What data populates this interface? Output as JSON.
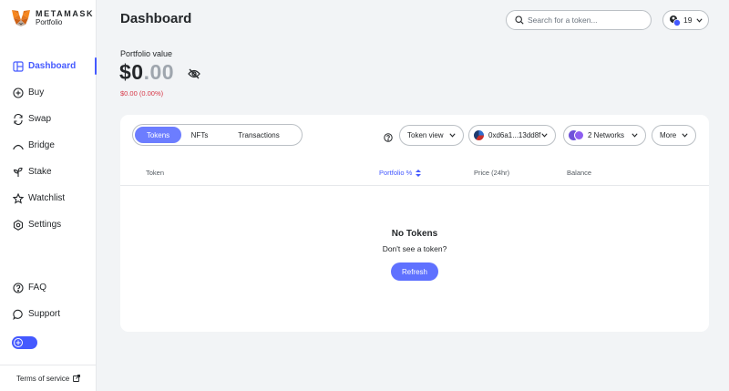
{
  "brand": {
    "title": "METAMASK",
    "subtitle": "Portfolio"
  },
  "sidebar": {
    "items": [
      {
        "label": "Dashboard",
        "icon": "dashboard-icon",
        "active": true
      },
      {
        "label": "Buy",
        "icon": "plus-circle-icon"
      },
      {
        "label": "Swap",
        "icon": "swap-icon"
      },
      {
        "label": "Bridge",
        "icon": "bridge-icon"
      },
      {
        "label": "Stake",
        "icon": "sprout-icon"
      },
      {
        "label": "Watchlist",
        "icon": "star-icon"
      },
      {
        "label": "Settings",
        "icon": "gear-icon"
      }
    ],
    "bottom_items": [
      {
        "label": "FAQ",
        "icon": "question-circle-icon"
      },
      {
        "label": "Support",
        "icon": "chat-bubble-icon"
      }
    ],
    "terms_label": "Terms of service"
  },
  "header": {
    "title": "Dashboard",
    "search_placeholder": "Search for a token...",
    "account_count": "19"
  },
  "portfolio": {
    "label": "Portfolio value",
    "value_dollars": "$0",
    "value_cents": ".00",
    "change": "$0.00 (0.00%)"
  },
  "card": {
    "tabs": [
      {
        "label": "Tokens",
        "active": true
      },
      {
        "label": "NFTs"
      },
      {
        "label": "Transactions"
      }
    ],
    "view_label": "Token view",
    "address_label": "0xd6a1...13dd8f",
    "networks_label": "2 Networks",
    "more_label": "More",
    "columns": {
      "token": "Token",
      "portfolio": "Portfolio %",
      "price": "Price (24hr)",
      "balance": "Balance"
    },
    "empty_title": "No Tokens",
    "empty_subtitle": "Don't see a token?",
    "refresh_label": "Refresh"
  },
  "colors": {
    "accent": "#4459ff",
    "negative": "#d73847"
  }
}
